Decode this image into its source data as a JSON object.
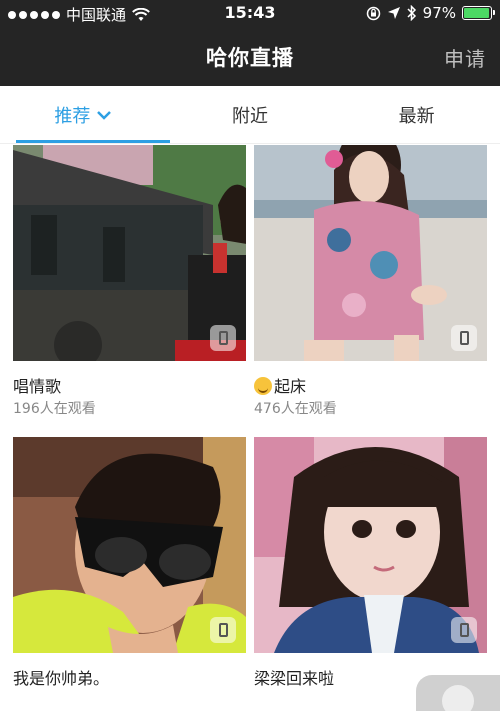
{
  "status_bar": {
    "carrier": "中国联通",
    "time": "15:43",
    "battery": "97%",
    "battery_level": 0.97,
    "battery_color": "#4cd964"
  },
  "nav": {
    "title": "哈你直播",
    "action": "申请"
  },
  "tabs": [
    {
      "label": "推荐",
      "active": true
    },
    {
      "label": "附近",
      "active": false
    },
    {
      "label": "最新",
      "active": false
    }
  ],
  "accent_color": "#2d9fe3",
  "streams": [
    {
      "title": "唱情歌",
      "viewers": "196人在观看",
      "emoji": false,
      "thumb_icon": "phone-icon"
    },
    {
      "title": "起床",
      "viewers": "476人在观看",
      "emoji": true,
      "thumb_icon": "phone-icon"
    },
    {
      "title": "我是你帅弟。",
      "viewers": "",
      "thumb_icon": "phone-icon"
    },
    {
      "title": "梁梁回来啦",
      "viewers": "",
      "thumb_icon": "phone-icon"
    }
  ]
}
